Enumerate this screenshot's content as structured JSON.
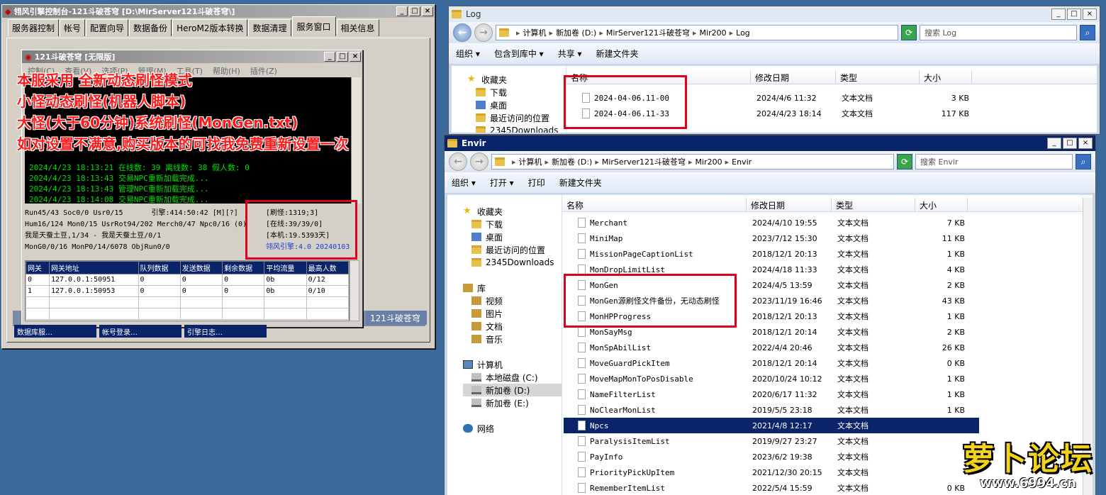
{
  "console": {
    "title": "翎风引擎控制台-121斗破苍穹 [D:\\MirServer121斗破苍穹\\]",
    "tabs": [
      "服务器控制",
      "帐号",
      "配置向导",
      "数据备份",
      "HeroM2版本转换",
      "数据清理",
      "服务窗口",
      "相关信息"
    ],
    "selected_tab": "服务窗口",
    "inner_title": "121斗破苍穹 [无限版]",
    "inner_menu": [
      "控制(C)",
      "查看(V)",
      "选项(P)",
      "管理(M)",
      "工具(T)",
      "帮助(H)",
      "插件(Z)"
    ],
    "log_lines": [
      "2024/4/23 18:13:21 在线数: 39 离线数: 38 假人数: 0",
      "2024/4/23 18:13:43 交易NPC重新加载完成...",
      "2024/4/23 18:13:43 管理NPC重新加载完成...",
      "2024/4/23 18:14:08 交易NPC重新加载完成..."
    ],
    "status": {
      "line1": "Run45/43 Soc0/0 Usr0/15",
      "line1b": "引擎:414:50:42 [M][?]",
      "line2": "Hum16/124 Mon0/15 UsrRot94/202 Merch0/47 Npc0/16 (0)",
      "line3": "我是天蚕土豆,1/34 - 我是天蚕土豆/0/1",
      "line4": "MonG0/0/16 MonP0/14/6078 ObjRun0/0",
      "right": [
        "[刷怪:1319;3]",
        "[在线:39/39/0]",
        "[本机:19.5393天]",
        "翎风引擎:4.0 20240103"
      ]
    },
    "gateway_headers": [
      "网关",
      "网关地址",
      "队列数据",
      "发送数据",
      "剩余数据",
      "平均流量",
      "最高人数"
    ],
    "gateway_rows": [
      [
        "0",
        "127.0.0.1:50951",
        "0",
        "0",
        "0",
        "0b",
        "0/12"
      ],
      [
        "1",
        "127.0.0.1:50953",
        "0",
        "0",
        "0",
        "0b",
        "0/10"
      ]
    ],
    "taskbar_items": [
      "数据库服…",
      "帐号登录…",
      "引擎日志…"
    ],
    "bottom_right": "121斗破苍穹"
  },
  "overlay_text": [
    "本服采用 全新动态刷怪模式",
    "小怪动态刷怪(机器人脚本)",
    "大怪(大于60分钟)系统刷怪(MonGen.txt)",
    "如对设置不满意,购买版本的可找我免费重新设置一次"
  ],
  "log_window": {
    "title": "Log",
    "address": [
      "计算机",
      "新加卷 (D:)",
      "MirServer121斗破苍穹",
      "Mir200",
      "Log"
    ],
    "search": "搜索 Log",
    "commands": [
      "组织 ▾",
      "包含到库中 ▾",
      "共享 ▾",
      "新建文件夹"
    ],
    "nav": [
      "收藏夹",
      "下载",
      "桌面",
      "最近访问的位置",
      "2345Downloads"
    ],
    "columns": [
      "名称",
      "修改日期",
      "类型",
      "大小"
    ],
    "files": [
      {
        "name": "2024-04-06.11-00",
        "date": "2024/4/6 11:32",
        "type": "文本文档",
        "size": "3 KB"
      },
      {
        "name": "2024-04-06.11-33",
        "date": "2024/4/23 18:14",
        "type": "文本文档",
        "size": "117 KB"
      }
    ]
  },
  "envir_window": {
    "title": "Envir",
    "address": [
      "计算机",
      "新加卷 (D:)",
      "MirServer121斗破苍穹",
      "Mir200",
      "Envir"
    ],
    "search": "搜索 Envir",
    "commands": [
      "组织 ▾",
      "打开 ▾",
      "打印",
      "新建文件夹"
    ],
    "nav": [
      {
        "label": "收藏夹",
        "icon": "star"
      },
      {
        "label": "下载",
        "icon": "fold"
      },
      {
        "label": "桌面",
        "icon": "blue"
      },
      {
        "label": "最近访问的位置",
        "icon": "fold"
      },
      {
        "label": "2345Downloads",
        "icon": "fold"
      },
      {
        "label": "",
        "icon": ""
      },
      {
        "label": "库",
        "icon": "lib"
      },
      {
        "label": "视频",
        "icon": "lib"
      },
      {
        "label": "图片",
        "icon": "lib"
      },
      {
        "label": "文档",
        "icon": "lib"
      },
      {
        "label": "音乐",
        "icon": "lib"
      },
      {
        "label": "",
        "icon": ""
      },
      {
        "label": "计算机",
        "icon": "pc"
      },
      {
        "label": "本地磁盘 (C:)",
        "icon": "drive"
      },
      {
        "label": "新加卷 (D:)",
        "icon": "drive"
      },
      {
        "label": "新加卷 (E:)",
        "icon": "drive"
      },
      {
        "label": "",
        "icon": ""
      },
      {
        "label": "网络",
        "icon": "net"
      }
    ],
    "columns": [
      "名称",
      "修改日期",
      "类型",
      "大小"
    ],
    "files": [
      {
        "name": "Merchant",
        "date": "2024/4/10 19:55",
        "type": "文本文档",
        "size": "7 KB"
      },
      {
        "name": "MiniMap",
        "date": "2023/7/12 15:30",
        "type": "文本文档",
        "size": "11 KB"
      },
      {
        "name": "MissionPageCaptionList",
        "date": "2018/12/1 20:13",
        "type": "文本文档",
        "size": "1 KB"
      },
      {
        "name": "MonDropLimitList",
        "date": "2024/4/18 11:33",
        "type": "文本文档",
        "size": "4 KB"
      },
      {
        "name": "MonGen",
        "date": "2024/4/5 13:59",
        "type": "文本文档",
        "size": "2 KB"
      },
      {
        "name": "MonGen源刷怪文件备份，无动态刷怪",
        "date": "2023/11/19 16:46",
        "type": "文本文档",
        "size": "43 KB"
      },
      {
        "name": "MonHPProgress",
        "date": "2018/12/1 20:13",
        "type": "文本文档",
        "size": "1 KB"
      },
      {
        "name": "MonSayMsg",
        "date": "2018/12/1 20:14",
        "type": "文本文档",
        "size": "2 KB"
      },
      {
        "name": "MonSpAbilList",
        "date": "2022/4/4 20:46",
        "type": "文本文档",
        "size": "26 KB"
      },
      {
        "name": "MoveGuardPickItem",
        "date": "2018/12/1 20:14",
        "type": "文本文档",
        "size": "0 KB"
      },
      {
        "name": "MoveMapMonToPosDisable",
        "date": "2020/10/24 10:12",
        "type": "文本文档",
        "size": "1 KB"
      },
      {
        "name": "NameFilterList",
        "date": "2020/6/17 11:32",
        "type": "文本文档",
        "size": "1 KB"
      },
      {
        "name": "NoClearMonList",
        "date": "2019/5/5 23:18",
        "type": "文本文档",
        "size": "1 KB"
      },
      {
        "name": "Npcs",
        "date": "2021/4/8 12:17",
        "type": "文本文档",
        "size": "",
        "selected": true
      },
      {
        "name": "ParalysisItemList",
        "date": "2019/9/27 23:27",
        "type": "文本文档",
        "size": ""
      },
      {
        "name": "PayInfo",
        "date": "2023/6/2 19:38",
        "type": "文本文档",
        "size": ""
      },
      {
        "name": "PriorityPickUpItem",
        "date": "2021/12/30 20:15",
        "type": "文本文档",
        "size": ""
      },
      {
        "name": "RememberItemList",
        "date": "2022/5/4 15:59",
        "type": "文本文档",
        "size": "0 KB"
      }
    ]
  },
  "watermark": {
    "brand": "萝卜论坛",
    "url": "www.6994.cn"
  }
}
